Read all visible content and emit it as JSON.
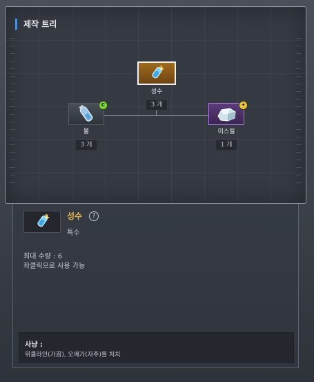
{
  "tree": {
    "title": "제작 트리",
    "root": {
      "name": "성수",
      "count": "3 개",
      "icon": "holy-water-icon"
    },
    "left": {
      "name": "물",
      "count": "3 개",
      "icon": "water-vial-icon",
      "badge": "C"
    },
    "right": {
      "name": "미스릴",
      "count": "1 개",
      "icon": "mithril-ore-icon",
      "badge": "✦"
    }
  },
  "detail": {
    "name": "성수",
    "help": "?",
    "grade": "특수",
    "max_qty": "최대 수량 : 6",
    "usage": "좌클릭으로 사용 가능",
    "hunt_title": "사냥 :",
    "hunt_desc": "위클라인(가끔), 오메가(자주)를 처치"
  },
  "colors": {
    "accent": "#4e8fd8",
    "item_name": "#e6b24a",
    "root_bg": "#a16a1e",
    "mithril_bg": "#5b3c7a",
    "badge_c": "#7fd63a",
    "badge_gold": "#e8c445"
  }
}
